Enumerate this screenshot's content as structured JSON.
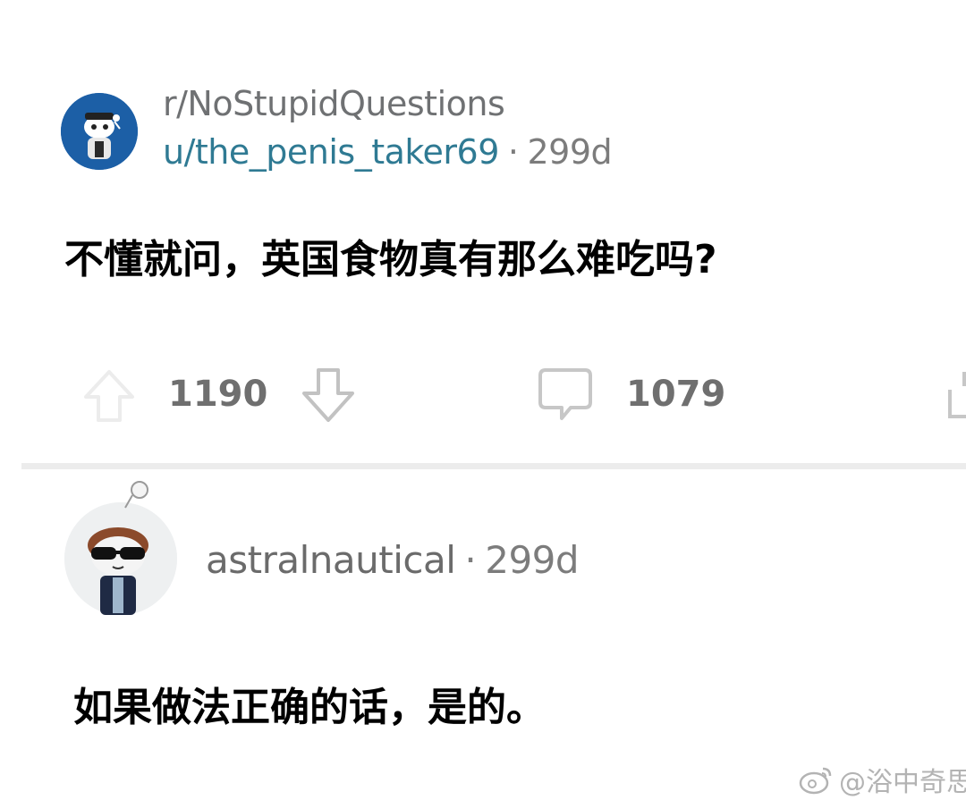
{
  "post": {
    "subreddit": "r/NoStupidQuestions",
    "author": "u/the_penis_taker69",
    "separator": "·",
    "age": "299d",
    "title": "不懂就问，英国食物真有那么难吃吗?"
  },
  "actions": {
    "upvote_icon": "upvote-arrow-icon",
    "vote_count": "1190",
    "downvote_icon": "downvote-arrow-icon",
    "comment_icon": "comment-bubble-icon",
    "comment_count": "1079",
    "share_icon": "share-icon"
  },
  "comment": {
    "author": "astralnautical",
    "separator": "·",
    "age": "299d",
    "body": "如果做法正确的话，是的。"
  },
  "watermark": {
    "logo": "weibo-logo",
    "text": "@浴中奇思"
  },
  "colors": {
    "author_link": "#2f7a93",
    "meta_gray": "#7c7c7c",
    "avatar_blue": "#1c5fa6",
    "divider": "#ececec"
  }
}
